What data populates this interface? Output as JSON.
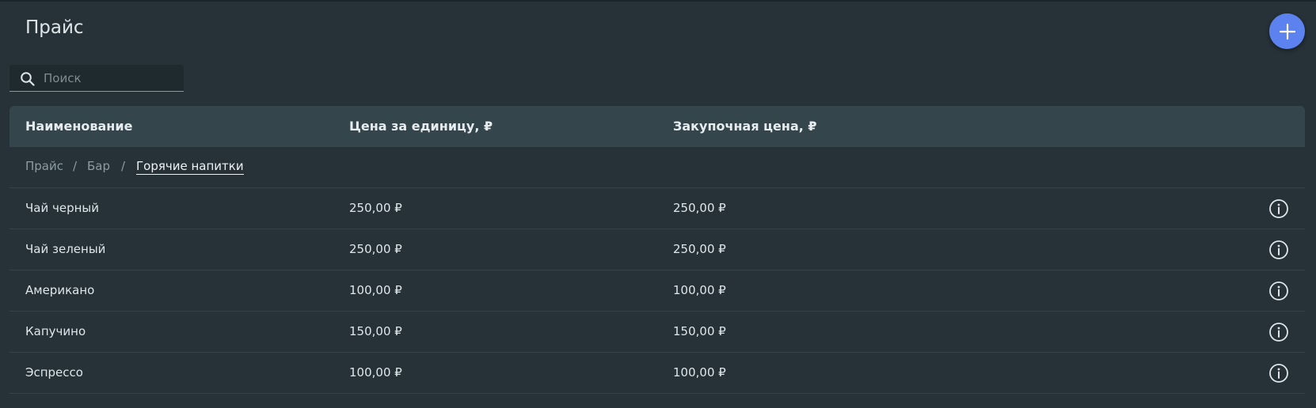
{
  "page": {
    "title": "Прайс"
  },
  "fab": {
    "icon": "plus-icon",
    "color": "#5b82ee"
  },
  "search": {
    "placeholder": "Поиск",
    "value": "",
    "icon": "search-icon"
  },
  "table": {
    "columns": [
      "Наименование",
      "Цена за единицу, ₽",
      "Закупочная цена, ₽"
    ],
    "breadcrumb": {
      "items": [
        "Прайс",
        "Бар"
      ],
      "separator": "/",
      "current": "Горячие напитки"
    },
    "rows": [
      {
        "name": "Чай черный",
        "price": "250,00 ₽",
        "cost": "250,00 ₽"
      },
      {
        "name": "Чай зеленый",
        "price": "250,00 ₽",
        "cost": "250,00 ₽"
      },
      {
        "name": "Американо",
        "price": "100,00 ₽",
        "cost": "100,00 ₽"
      },
      {
        "name": "Капучино",
        "price": "150,00 ₽",
        "cost": "150,00 ₽"
      },
      {
        "name": "Эспрессо",
        "price": "100,00 ₽",
        "cost": "100,00 ₽"
      }
    ],
    "row_action_icon": "info-icon"
  },
  "colors": {
    "background": "#263238",
    "header": "#34454c",
    "accent": "#5b82ee"
  }
}
